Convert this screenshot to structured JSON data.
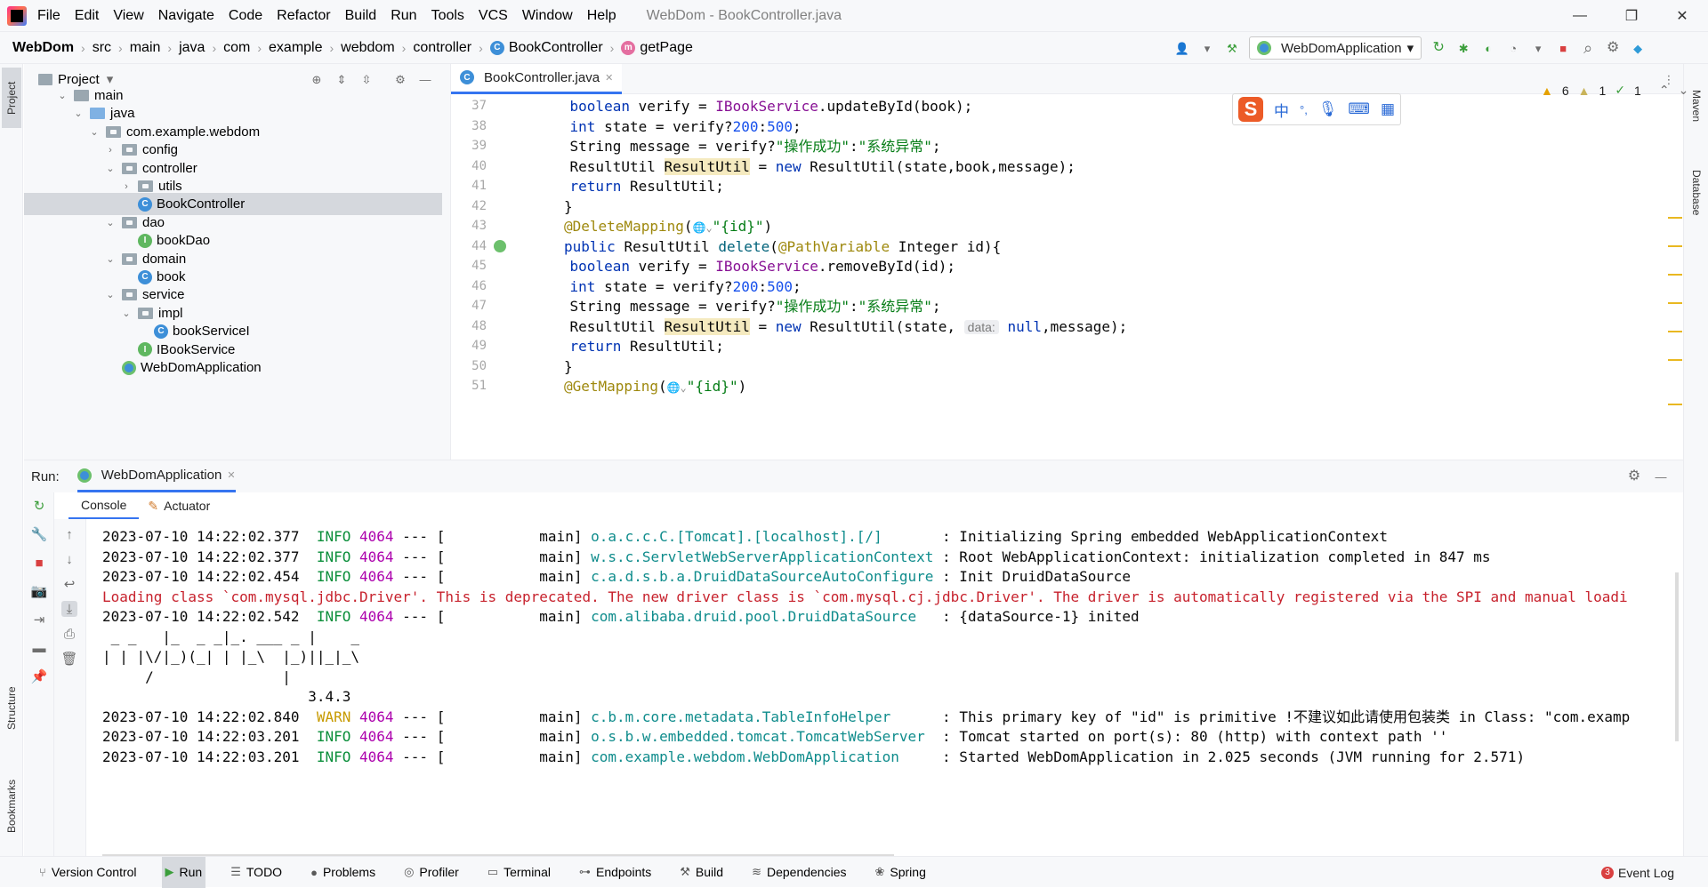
{
  "app": {
    "window_title": "WebDom - BookController.java",
    "menu": [
      "File",
      "Edit",
      "View",
      "Navigate",
      "Code",
      "Refactor",
      "Build",
      "Run",
      "Tools",
      "VCS",
      "Window",
      "Help"
    ]
  },
  "breadcrumbs": [
    "WebDom",
    "src",
    "main",
    "java",
    "com",
    "example",
    "webdom",
    "controller",
    "BookController",
    "getPage"
  ],
  "run_config": "WebDomApplication",
  "left_tools": [
    "Project",
    "Structure",
    "Bookmarks"
  ],
  "right_tools": [
    "Maven",
    "Database"
  ],
  "project": {
    "title": "Project",
    "tree": [
      {
        "label": "main",
        "depth": 0,
        "type": "folder",
        "open": true
      },
      {
        "label": "java",
        "depth": 1,
        "type": "folder-blue",
        "open": true
      },
      {
        "label": "com.example.webdom",
        "depth": 2,
        "type": "package",
        "open": true
      },
      {
        "label": "config",
        "depth": 3,
        "type": "package",
        "open": false
      },
      {
        "label": "controller",
        "depth": 3,
        "type": "package",
        "open": true
      },
      {
        "label": "utils",
        "depth": 4,
        "type": "package",
        "open": false
      },
      {
        "label": "BookController",
        "depth": 4,
        "type": "class",
        "selected": true
      },
      {
        "label": "dao",
        "depth": 3,
        "type": "package",
        "open": true
      },
      {
        "label": "bookDao",
        "depth": 4,
        "type": "interface"
      },
      {
        "label": "domain",
        "depth": 3,
        "type": "package",
        "open": true
      },
      {
        "label": "book",
        "depth": 4,
        "type": "class"
      },
      {
        "label": "service",
        "depth": 3,
        "type": "package",
        "open": true
      },
      {
        "label": "impl",
        "depth": 4,
        "type": "package",
        "open": true
      },
      {
        "label": "bookServiceI",
        "depth": 5,
        "type": "class"
      },
      {
        "label": "IBookService",
        "depth": 4,
        "type": "interface"
      },
      {
        "label": "WebDomApplication",
        "depth": 3,
        "type": "spring"
      }
    ]
  },
  "editor": {
    "tab": "BookController.java",
    "inspections": {
      "warnings": "6",
      "weak": "1",
      "ok": "1"
    },
    "ime": {
      "logo": "S",
      "lang": "中",
      "punct": "°,"
    },
    "line_numbers": [
      "37",
      "38",
      "39",
      "40",
      "41",
      "42",
      "43",
      "44",
      "45",
      "46",
      "47",
      "48",
      "49",
      "50",
      "51"
    ],
    "lines": [
      [
        [
          "    boolean ",
          "kw"
        ],
        [
          "verify = ",
          ""
        ],
        [
          "IBookService",
          "fld"
        ],
        [
          ".updateById(book);",
          ""
        ]
      ],
      [
        [
          "    int ",
          "kw"
        ],
        [
          "state = verify?",
          ""
        ],
        [
          "200",
          "num"
        ],
        [
          ":",
          ""
        ],
        [
          "500",
          "num"
        ],
        [
          ";",
          ""
        ]
      ],
      [
        [
          "    String message = verify?",
          ""
        ],
        [
          "\"操作成功\"",
          "str"
        ],
        [
          ":",
          ""
        ],
        [
          "\"系统异常\"",
          "str"
        ],
        [
          ";",
          ""
        ]
      ],
      [
        [
          "    ResultUtil ",
          ""
        ],
        [
          "ResultUtil",
          "hl"
        ],
        [
          " = ",
          ""
        ],
        [
          "new ",
          "kw"
        ],
        [
          "ResultUtil(state,book,message);",
          ""
        ]
      ],
      [
        [
          "    return ",
          "kw"
        ],
        [
          "ResultUtil;",
          ""
        ]
      ],
      [
        [
          "}",
          ""
        ]
      ],
      [
        [
          "@DeleteMapping",
          "ann"
        ],
        [
          "(",
          ""
        ],
        [
          "🌐⌄",
          "icon"
        ],
        [
          "\"{id}\"",
          "str"
        ],
        [
          ")",
          ""
        ]
      ],
      [
        [
          "public ",
          "kw"
        ],
        [
          "ResultUtil ",
          ""
        ],
        [
          "delete",
          "fn"
        ],
        [
          "(",
          ""
        ],
        [
          "@PathVariable ",
          "ann"
        ],
        [
          "Integer id){",
          ""
        ]
      ],
      [
        [
          "    boolean ",
          "kw"
        ],
        [
          "verify = ",
          ""
        ],
        [
          "IBookService",
          "fld"
        ],
        [
          ".removeById(id);",
          ""
        ]
      ],
      [
        [
          "    int ",
          "kw"
        ],
        [
          "state = verify?",
          ""
        ],
        [
          "200",
          "num"
        ],
        [
          ":",
          ""
        ],
        [
          "500",
          "num"
        ],
        [
          ";",
          ""
        ]
      ],
      [
        [
          "    String message = verify?",
          ""
        ],
        [
          "\"操作成功\"",
          "str"
        ],
        [
          ":",
          ""
        ],
        [
          "\"系统异常\"",
          "str"
        ],
        [
          ";",
          ""
        ]
      ],
      [
        [
          "    ResultUtil ",
          ""
        ],
        [
          "ResultUtil",
          "hl"
        ],
        [
          " = ",
          ""
        ],
        [
          "new ",
          "kw"
        ],
        [
          "ResultUtil(state, ",
          ""
        ],
        [
          "data:",
          "hint"
        ],
        [
          " ",
          ""
        ],
        [
          "null",
          "kw"
        ],
        [
          ",message);",
          ""
        ]
      ],
      [
        [
          "    return ",
          "kw"
        ],
        [
          "ResultUtil;",
          ""
        ]
      ],
      [
        [
          "}",
          ""
        ]
      ],
      [
        [
          "@GetMapping",
          "ann"
        ],
        [
          "(",
          ""
        ],
        [
          "🌐⌄",
          "icon"
        ],
        [
          "\"{id}\"",
          "str"
        ],
        [
          ")",
          ""
        ]
      ]
    ]
  },
  "run": {
    "label": "Run:",
    "tab": "WebDomApplication",
    "subtabs": [
      "Console",
      "Actuator"
    ],
    "console": [
      [
        [
          "2023-07-10 14:22:02.377  ",
          ""
        ],
        [
          "INFO",
          "info"
        ],
        [
          " ",
          ""
        ],
        [
          "4064",
          "pid"
        ],
        [
          " --- [           main] ",
          ""
        ],
        [
          "o.a.c.c.C.[Tomcat].[localhost].[/]",
          "logger"
        ],
        [
          "       : Initializing Spring embedded WebApplicationContext",
          ""
        ]
      ],
      [
        [
          "2023-07-10 14:22:02.377  ",
          ""
        ],
        [
          "INFO",
          "info"
        ],
        [
          " ",
          ""
        ],
        [
          "4064",
          "pid"
        ],
        [
          " --- [           main] ",
          ""
        ],
        [
          "w.s.c.ServletWebServerApplicationContext",
          "logger"
        ],
        [
          " : Root WebApplicationContext: initialization completed in 847 ms",
          ""
        ]
      ],
      [
        [
          "2023-07-10 14:22:02.454  ",
          ""
        ],
        [
          "INFO",
          "info"
        ],
        [
          " ",
          ""
        ],
        [
          "4064",
          "pid"
        ],
        [
          " --- [           main] ",
          ""
        ],
        [
          "c.a.d.s.b.a.DruidDataSourceAutoConfigure",
          "logger"
        ],
        [
          " : Init DruidDataSource",
          ""
        ]
      ],
      [
        [
          "Loading class `com.mysql.jdbc.Driver'. This is deprecated. The new driver class is `com.mysql.cj.jdbc.Driver'. The driver is automatically registered via the SPI and manual loadi",
          "err"
        ]
      ],
      [
        [
          "2023-07-10 14:22:02.542  ",
          ""
        ],
        [
          "INFO",
          "info"
        ],
        [
          " ",
          ""
        ],
        [
          "4064",
          "pid"
        ],
        [
          " --- [           main] ",
          ""
        ],
        [
          "com.alibaba.druid.pool.DruidDataSource",
          "logger"
        ],
        [
          "   : {dataSource-1} inited",
          ""
        ]
      ],
      [
        [
          " _ _   |_  _ _|_. ___ _ |    _ ",
          ""
        ]
      ],
      [
        [
          "| | |\\/|_)(_| | |_\\  |_)||_|_\\ ",
          ""
        ]
      ],
      [
        [
          "     /               |",
          ""
        ]
      ],
      [
        [
          "                        3.4.3",
          ""
        ]
      ],
      [
        [
          "2023-07-10 14:22:02.840  ",
          ""
        ],
        [
          "WARN",
          "warn"
        ],
        [
          " ",
          ""
        ],
        [
          "4064",
          "pid"
        ],
        [
          " --- [           main] ",
          ""
        ],
        [
          "c.b.m.core.metadata.TableInfoHelper",
          "logger"
        ],
        [
          "      : This primary key of \"id\" is primitive !不建议如此请使用包装类 in Class: \"com.examp",
          ""
        ]
      ],
      [
        [
          "2023-07-10 14:22:03.201  ",
          ""
        ],
        [
          "INFO",
          "info"
        ],
        [
          " ",
          ""
        ],
        [
          "4064",
          "pid"
        ],
        [
          " --- [           main] ",
          ""
        ],
        [
          "o.s.b.w.embedded.tomcat.TomcatWebServer",
          "logger"
        ],
        [
          "  : Tomcat started on port(s): 80 (http) with context path ''",
          ""
        ]
      ],
      [
        [
          "2023-07-10 14:22:03.201  ",
          ""
        ],
        [
          "INFO",
          "info"
        ],
        [
          " ",
          ""
        ],
        [
          "4064",
          "pid"
        ],
        [
          " --- [           main] ",
          ""
        ],
        [
          "com.example.webdom.WebDomApplication",
          "logger"
        ],
        [
          "     : Started WebDomApplication in 2.025 seconds (JVM running for 2.571)",
          ""
        ]
      ]
    ]
  },
  "bottom_tabs": [
    "Version Control",
    "Run",
    "TODO",
    "Problems",
    "Profiler",
    "Terminal",
    "Endpoints",
    "Build",
    "Dependencies",
    "Spring"
  ],
  "event_log": {
    "count": "3",
    "label": "Event Log"
  },
  "icons": {
    "close": "✕",
    "minimize": "—",
    "maximize": "❐",
    "chevron_down": "▾",
    "chevron_right": "›",
    "settings": "⚙",
    "search": "⌕",
    "rerun": "↻",
    "stop": "■",
    "hammer": "⚒"
  },
  "colors": {
    "accent": "#3574f0",
    "keyword": "#0033b3",
    "string": "#067d17",
    "info": "#0a8e3a",
    "error": "#c7222d"
  }
}
